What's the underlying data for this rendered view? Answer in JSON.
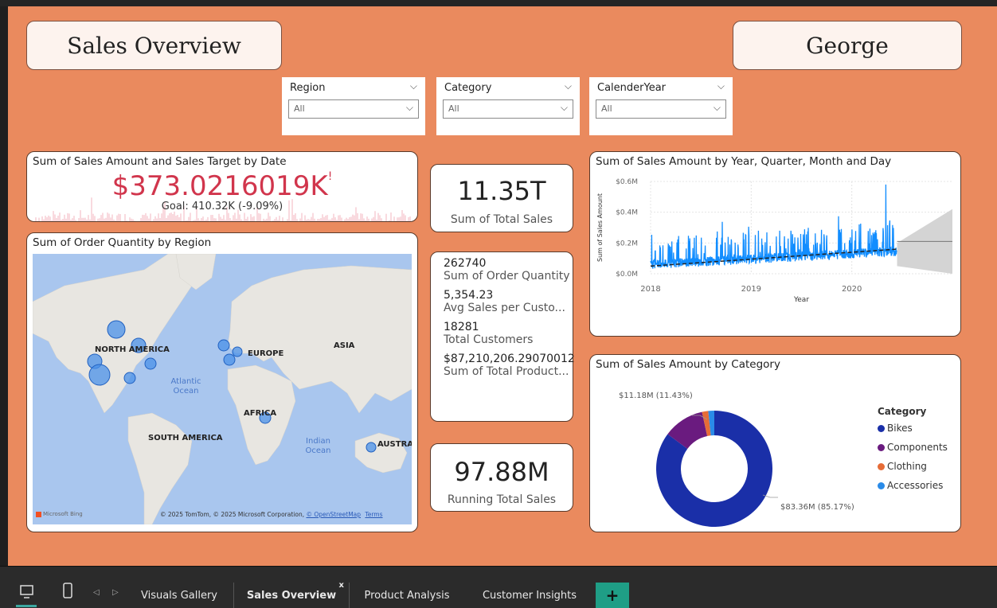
{
  "page": {
    "title": "Sales Overview",
    "user": "George"
  },
  "slicers": [
    {
      "label": "Region",
      "value": "All"
    },
    {
      "label": "Category",
      "value": "All"
    },
    {
      "label": "CalenderYear",
      "value": "All"
    }
  ],
  "kpi": {
    "title": "Sum of Sales Amount and Sales Target by Date",
    "value": "$373.0216019K",
    "indicator": "!",
    "goal": "Goal: 410.32K (-9.09%)",
    "value_color": "#d1354c"
  },
  "cards": {
    "total_sales": {
      "value": "11.35T",
      "label": "Sum of Total Sales"
    },
    "running_total": {
      "value": "97.88M",
      "label": "Running Total Sales"
    }
  },
  "multirow": [
    {
      "value": "262740",
      "label": "Sum of Order Quantity"
    },
    {
      "value": "5,354.23",
      "label": "Avg Sales per Custo..."
    },
    {
      "value": "18281",
      "label": "Total Customers"
    },
    {
      "value": "$87,210,206.29070012",
      "label": "Sum of Total Product..."
    }
  ],
  "map": {
    "title": "Sum of Order Quantity by Region",
    "labels": {
      "north_america": "NORTH AMERICA",
      "europe": "EUROPE",
      "asia": "ASIA",
      "africa": "AFRICA",
      "south_america": "SOUTH AMERICA",
      "australia": "AUSTRALIA",
      "atlantic": "Atlantic Ocean",
      "indian": "Indian Ocean"
    },
    "bing": "Microsoft Bing",
    "copyright": "© 2025 TomTom, © 2025 Microsoft Corporation,",
    "osm": "© OpenStreetMap",
    "terms": "Terms"
  },
  "line_chart": {
    "title": "Sum of Sales Amount by Year, Quarter, Month and Day",
    "xlabel": "Year",
    "ylabel": "Sum of Sales Amount",
    "y_ticks": [
      "$0.6M",
      "$0.4M",
      "$0.2M",
      "$0.0M"
    ],
    "x_ticks": [
      "2018",
      "2019",
      "2020"
    ]
  },
  "donut": {
    "title": "Sum of Sales Amount by Category",
    "legend_title": "Category",
    "label_small": "$11.18M (11.43%)",
    "label_big": "$83.36M (85.17%)"
  },
  "chart_data": [
    {
      "type": "line",
      "title": "Sum of Sales Amount by Year, Quarter, Month and Day",
      "xlabel": "Year",
      "ylabel": "Sum of Sales Amount",
      "x_range": [
        2018.0,
        2020.55
      ],
      "ylim": [
        0,
        0.6
      ],
      "y_unit": "$M",
      "series": [
        {
          "values_summary": "daily sales amount, mostly between $0.02M and $0.25M, peaks up to ~$0.58M near mid-2020"
        }
      ],
      "trend": {
        "from": [
          2018.0,
          0.05
        ],
        "to": [
          2020.45,
          0.16
        ]
      },
      "forecast": {
        "start": 2020.45,
        "end": 2021.0,
        "center": 0.21,
        "upper": 0.42,
        "lower": 0.0
      }
    },
    {
      "type": "pie",
      "title": "Sum of Sales Amount by Category",
      "categories": [
        "Bikes",
        "Components",
        "Clothing",
        "Accessories"
      ],
      "values": [
        85.17,
        11.43,
        1.73,
        1.67
      ],
      "colors": [
        "#1a2fa8",
        "#6a1b7f",
        "#e66c37",
        "#2a8be8"
      ],
      "data_labels": [
        "$83.36M (85.17%)",
        "$11.18M (11.43%)"
      ]
    }
  ],
  "tabs": {
    "items": [
      "Visuals Gallery",
      "Sales Overview",
      "Product Analysis",
      "Customer Insights"
    ],
    "close": "x",
    "add": "+"
  }
}
